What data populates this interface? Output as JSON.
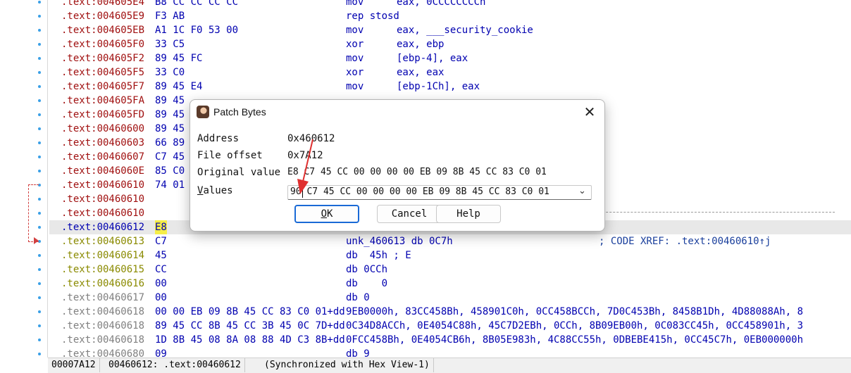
{
  "listing": [
    {
      "addr": ".text:004605E4",
      "bytes": "B8 CC CC CC CC",
      "mnemonic": "mov",
      "operands": "eax, 0CCCCCCCCh",
      "kind": "text"
    },
    {
      "addr": ".text:004605E9",
      "bytes": "F3 AB",
      "mnemonic": "rep stosd",
      "operands": "",
      "kind": "text"
    },
    {
      "addr": ".text:004605EB",
      "bytes": "A1 1C F0 53 00",
      "mnemonic": "mov",
      "operands": "eax, ___security_cookie",
      "kind": "text"
    },
    {
      "addr": ".text:004605F0",
      "bytes": "33 C5",
      "mnemonic": "xor",
      "operands": "eax, ebp",
      "kind": "text"
    },
    {
      "addr": ".text:004605F2",
      "bytes": "89 45 FC",
      "mnemonic": "mov",
      "operands": "[ebp-4], eax",
      "kind": "text"
    },
    {
      "addr": ".text:004605F5",
      "bytes": "33 C0",
      "mnemonic": "xor",
      "operands": "eax, eax",
      "kind": "text"
    },
    {
      "addr": ".text:004605F7",
      "bytes": "89 45 E4",
      "mnemonic": "mov",
      "operands": "[ebp-1Ch], eax",
      "kind": "text"
    },
    {
      "addr": ".text:004605FA",
      "bytes": "89 45",
      "mnemonic": "",
      "operands": "",
      "kind": "text"
    },
    {
      "addr": ".text:004605FD",
      "bytes": "89 45",
      "mnemonic": "",
      "operands": "",
      "kind": "text"
    },
    {
      "addr": ".text:00460600",
      "bytes": "89 45",
      "mnemonic": "",
      "operands": "",
      "kind": "text"
    },
    {
      "addr": ".text:00460603",
      "bytes": "66 89",
      "mnemonic": "",
      "operands": "",
      "kind": "text"
    },
    {
      "addr": ".text:00460607",
      "bytes": "C7 45",
      "mnemonic": "",
      "operands": "",
      "kind": "text"
    },
    {
      "addr": ".text:0046060E",
      "bytes": "85 C0",
      "mnemonic": "",
      "operands": "",
      "kind": "text"
    },
    {
      "addr": ".text:00460610",
      "bytes": "74 01",
      "mnemonic": "",
      "operands": "",
      "kind": "text"
    },
    {
      "addr": ".text:00460610",
      "bytes": "",
      "mnemonic": "",
      "operands": "",
      "kind": "text"
    },
    {
      "addr": ".text:00460610",
      "bytes": "",
      "mnemonic": "",
      "operands": "",
      "kind": "text"
    },
    {
      "addr": ".text:00460612",
      "bytes": "E8",
      "mnemonic": "",
      "operands": "",
      "kind": "selected"
    },
    {
      "addr": ".text:00460613",
      "bytes": "C7",
      "full": "unk_460613 db 0C7h",
      "comment": "; CODE XREF: .text:00460610↑j",
      "kind": "data"
    },
    {
      "addr": ".text:00460614",
      "bytes": "45",
      "full": "db  45h ; E",
      "kind": "data"
    },
    {
      "addr": ".text:00460615",
      "bytes": "CC",
      "full": "db 0CCh",
      "kind": "data"
    },
    {
      "addr": ".text:00460616",
      "bytes": "00",
      "full": "db    0",
      "kind": "data"
    },
    {
      "addr": ".text:00460617",
      "bytes": "00",
      "full": "db 0",
      "kind": "undef"
    },
    {
      "addr": ".text:00460618",
      "bytes": "00 00 EB 09 8B 45 CC 83 C0 01+dd",
      "full": "9EB0000h, 83CC458Bh, 458901C0h, 0CC458BCCh, 7D0C453Bh, 8458B1Dh, 4D88088Ah, 8",
      "kind": "undef"
    },
    {
      "addr": ".text:00460618",
      "bytes": "89 45 CC 8B 45 CC 3B 45 0C 7D+dd",
      "full": "0C34D8ACCh, 0E4054C88h, 45C7D2EBh, 0CCh, 8B09EB00h, 0C083CC45h, 0CC458901h, 3",
      "kind": "undef"
    },
    {
      "addr": ".text:00460618",
      "bytes": "1D 8B 45 08 8A 08 88 4D C3 8B+dd",
      "full": "0FCC458Bh, 0E4054CB6h, 8B05E983h, 4C88CC55h, 0DBEBE415h, 0CC45C7h, 0EB000000h",
      "kind": "undef"
    },
    {
      "addr": ".text:00460680",
      "bytes": "09",
      "full": "db 9",
      "kind": "undef"
    }
  ],
  "dialog": {
    "title": "Patch Bytes",
    "close_glyph": "✕",
    "address_label": "Address",
    "address_value": "0x460612",
    "file_offset_label": "File offset",
    "file_offset_value": "0x7A12",
    "original_label": "Original value",
    "original_value": "E8 C7 45 CC 00 00 00 00 EB 09 8B 45 CC 83 C0 01",
    "values_label": "Values",
    "values_value": "90 C7 45 CC 00 00 00 00 EB 09 8B 45 CC 83 C0 01",
    "ok_label": "OK",
    "cancel_label": "Cancel",
    "help_label": "Help"
  },
  "status": {
    "offset": "00007A12",
    "location": "00460612: .text:00460612",
    "sync": "(Synchronized with Hex View-1)"
  },
  "colors": {
    "selection_highlight": "#f5ee48",
    "ok_border": "#1a6ad6",
    "annotation_arrow": "#e03030"
  }
}
